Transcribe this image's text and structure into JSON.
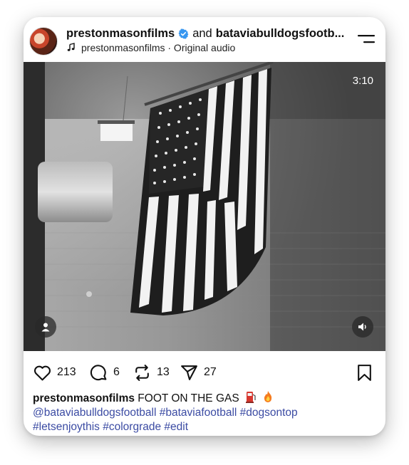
{
  "post": {
    "author": "prestonmasonfilms",
    "connector": "and",
    "collaborator": "bataviabulldogsfootb...",
    "audio": "prestonmasonfilms · Original audio"
  },
  "video": {
    "duration": "3:10"
  },
  "actions": {
    "likes": "213",
    "comments": "6",
    "reposts": "13",
    "shares": "27"
  },
  "caption": {
    "username": "prestonmasonfilms",
    "text": "FOOT ON THE GAS",
    "hashtags_line1": [
      "@bataviabulldogsfootball",
      "#bataviafootball",
      "#dogsontop"
    ],
    "hashtags_line2": [
      "#letsenjoythis",
      "#colorgrade",
      "#edit"
    ]
  },
  "icons": {
    "verified": "verified-badge-icon",
    "audio": "music-note-icon",
    "menu": "hamburger-menu-icon",
    "profile": "person-icon",
    "mute": "speaker-icon",
    "like": "heart-icon",
    "comment": "comment-bubble-icon",
    "repost": "repost-icon",
    "share": "paper-plane-icon",
    "save": "bookmark-icon",
    "fuel": "fuel-pump-emoji",
    "fire": "fire-emoji"
  },
  "colors": {
    "verified": "#3897f0",
    "hashtag": "#3b4ba3",
    "text": "#111111"
  }
}
